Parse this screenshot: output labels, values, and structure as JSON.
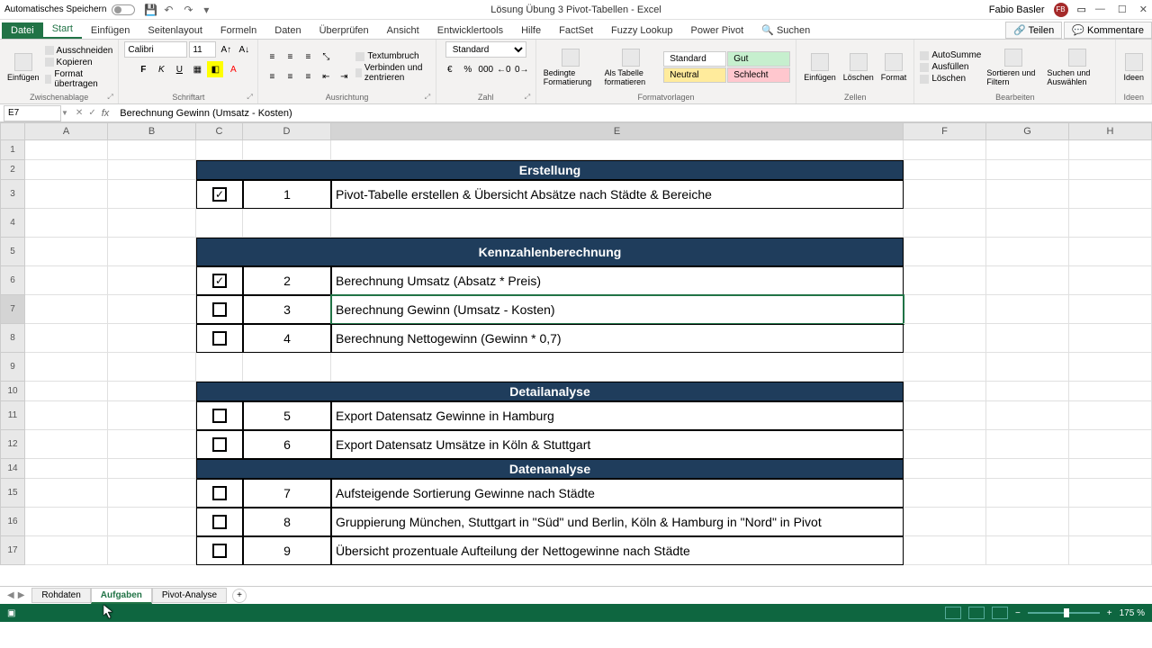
{
  "titlebar": {
    "autosave": "Automatisches Speichern",
    "filename": "Lösung Übung 3 Pivot-Tabellen - Excel",
    "username": "Fabio Basler",
    "avatar_initials": "FB"
  },
  "tabs": {
    "file": "Datei",
    "items": [
      "Start",
      "Einfügen",
      "Seitenlayout",
      "Formeln",
      "Daten",
      "Überprüfen",
      "Ansicht",
      "Entwicklertools",
      "Hilfe",
      "FactSet",
      "Fuzzy Lookup",
      "Power Pivot"
    ],
    "search": "Suchen",
    "share": "Teilen",
    "comments": "Kommentare"
  },
  "ribbon": {
    "clipboard": {
      "label": "Zwischenablage",
      "paste": "Einfügen",
      "cut": "Ausschneiden",
      "copy": "Kopieren",
      "format": "Format übertragen"
    },
    "font": {
      "label": "Schriftart",
      "name": "Calibri",
      "size": "11"
    },
    "align": {
      "label": "Ausrichtung",
      "wrap": "Textumbruch",
      "merge": "Verbinden und zentrieren"
    },
    "number": {
      "label": "Zahl",
      "format": "Standard"
    },
    "styles": {
      "label": "Formatvorlagen",
      "cond": "Bedingte Formatierung",
      "table": "Als Tabelle formatieren",
      "std": "Standard",
      "gut": "Gut",
      "neu": "Neutral",
      "sch": "Schlecht"
    },
    "cells": {
      "label": "Zellen",
      "insert": "Einfügen",
      "delete": "Löschen",
      "format": "Format"
    },
    "editing": {
      "label": "Bearbeiten",
      "sum": "AutoSumme",
      "fill": "Ausfüllen",
      "clear": "Löschen",
      "sort": "Sortieren und Filtern",
      "find": "Suchen und Auswählen"
    },
    "ideas": {
      "label": "Ideen",
      "btn": "Ideen"
    }
  },
  "namebox": "E7",
  "formula": "Berechnung Gewinn (Umsatz - Kosten)",
  "columns": [
    "A",
    "B",
    "C",
    "D",
    "E",
    "F",
    "G",
    "H"
  ],
  "rows": {
    "h1": "Erstellung",
    "r3": {
      "chk": true,
      "num": "1",
      "text": "Pivot-Tabelle erstellen & Übersicht Absätze nach Städte & Bereiche"
    },
    "h5": "Kennzahlenberechnung",
    "r6": {
      "chk": true,
      "num": "2",
      "text": "Berechnung Umsatz (Absatz * Preis)"
    },
    "r7": {
      "chk": false,
      "num": "3",
      "text": "Berechnung Gewinn (Umsatz - Kosten)"
    },
    "r8": {
      "chk": false,
      "num": "4",
      "text": "Berechnung Nettogewinn (Gewinn * 0,7)"
    },
    "h10": "Detailanalyse",
    "r11": {
      "chk": false,
      "num": "5",
      "text": "Export Datensatz Gewinne in Hamburg"
    },
    "r12": {
      "chk": false,
      "num": "6",
      "text": "Export Datensatz Umsätze in Köln & Stuttgart"
    },
    "h14": "Datenanalyse",
    "r15": {
      "chk": false,
      "num": "7",
      "text": "Aufsteigende Sortierung Gewinne nach Städte"
    },
    "r16": {
      "chk": false,
      "num": "8",
      "text": "Gruppierung München, Stuttgart in \"Süd\" und Berlin, Köln & Hamburg in \"Nord\" in Pivot"
    },
    "r17": {
      "chk": false,
      "num": "9",
      "text": "Übersicht prozentuale Aufteilung der Nettogewinne nach Städte"
    }
  },
  "sheets": [
    "Rohdaten",
    "Aufgaben",
    "Pivot-Analyse"
  ],
  "zoom": "175 %"
}
